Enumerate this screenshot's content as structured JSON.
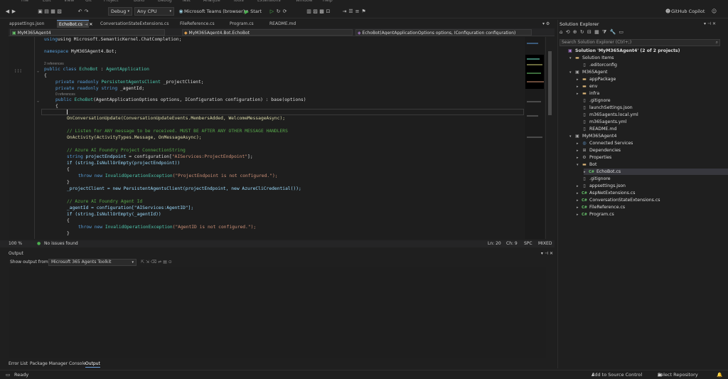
{
  "menubar": [
    "File",
    "Edit",
    "View",
    "Git",
    "Project",
    "Build",
    "Debug",
    "Test",
    "Analyze",
    "Tools",
    "Extensions",
    "Window",
    "Help"
  ],
  "toolbar": {
    "config": "Debug",
    "platform": "Any CPU",
    "launch_target": "Microsoft Teams (browser)",
    "start_label": "Start",
    "copilot_label": "GitHub Copilot"
  },
  "tabs": [
    {
      "label": "appsettings.json",
      "active": false
    },
    {
      "label": "EchoBot.cs",
      "active": true
    },
    {
      "label": "ConversationStateExtensions.cs",
      "active": false
    },
    {
      "label": "FileReference.cs",
      "active": false
    },
    {
      "label": "Program.cs",
      "active": false
    },
    {
      "label": "README.md",
      "active": false
    }
  ],
  "navbar": {
    "project": "MyM365Agent4",
    "class": "MyM365Agent4.Bot.EchoBot",
    "member": "EchoBot(AgentApplicationOptions options, IConfiguration configuration)"
  },
  "code": {
    "line_using": "using Microsoft.SemanticKernel.ChatCompletion;",
    "line_ns_kw": "namespace",
    "line_ns": " MyM365Agent4.Bot;",
    "refs_2": "2 references",
    "refs_0": "0 references",
    "class_kw": "public class",
    "class_name": " EchoBot",
    "class_base": " : ",
    "class_base_name": "AgentApplication",
    "brace_open": "{",
    "brace_close": "}",
    "field1_kw": "private readonly",
    "field1_type": " PersistentAgentsClient",
    "field1_name": " _projectClient;",
    "field2_kw": "private readonly string",
    "field2_name": " _agentId;",
    "ctor_kw": "public",
    "ctor_name": " EchoBot",
    "ctor_args": "(AgentApplicationOptions options, IConfiguration configuration) : base(options)",
    "onconv": "OnConversationUpdate(ConversationUpdateEvents.MembersAdded, WelcomeMessageAsync);",
    "comment1": "// Listen for ANY message to be received. MUST BE AFTER ANY OTHER MESSAGE HANDLERS",
    "onactivity": "OnActivity(ActivityTypes.Message, OnMessageAsync);",
    "comment2": "// Azure AI Foundry Project ConnectionString",
    "pe_kw": "string",
    "pe_name": " projectEndpoint",
    "pe_assign": " = configuration[",
    "pe_str": "\"AIServices:ProjectEndpoint\"",
    "pe_end": "];",
    "if1": "if (string.IsNullOrEmpty(projectEndpoint))",
    "throw_kw": "throw new",
    "throw_type": " InvalidOperationException",
    "throw1_str": "(\"ProjectEndpoint is not configured.\");",
    "projclient": "_projectClient = new PersistentAgentsClient(projectEndpoint, new AzureCliCredential());",
    "comment3": "// Azure AI Foundry Agent Id",
    "agentid": "_agentId = configuration[\"AIServices:AgentID\"];",
    "if2": "if (string.IsNullOrEmpty(_agentId))",
    "throw2_str": "(\"AgentID is not configured.\");"
  },
  "editor_status": {
    "zoom": "100 %",
    "issues": "No issues found",
    "line": "Ln: 20",
    "col": "Ch: 9",
    "spc": "SPC",
    "eol": "MIXED"
  },
  "output": {
    "title": "Output",
    "show_from": "Show output from:",
    "source": "Microsoft 365 Agents Toolkit"
  },
  "bottom_tabs": [
    "Error List",
    "Package Manager Console",
    "Output"
  ],
  "status": {
    "ready": "Ready",
    "source_control": "Add to Source Control",
    "repo": "Select Repository"
  },
  "solution_explorer": {
    "title": "Solution Explorer",
    "search_placeholder": "Search Solution Explorer (Ctrl+;)",
    "items": [
      {
        "label": "Solution 'MyM365Agent4' (2 of 2 projects)",
        "depth": 0,
        "kind": "solution",
        "arrow": ""
      },
      {
        "label": "Solution Items",
        "depth": 1,
        "kind": "folder",
        "arrow": "▾"
      },
      {
        "label": ".editorconfig",
        "depth": 2,
        "kind": "file",
        "arrow": ""
      },
      {
        "label": "M365Agent",
        "depth": 1,
        "kind": "project",
        "arrow": "▾"
      },
      {
        "label": "appPackage",
        "depth": 2,
        "kind": "folder",
        "arrow": "▸"
      },
      {
        "label": "env",
        "depth": 2,
        "kind": "folder",
        "arrow": "▸"
      },
      {
        "label": "infra",
        "depth": 2,
        "kind": "folder",
        "arrow": "▸"
      },
      {
        "label": ".gitignore",
        "depth": 2,
        "kind": "file",
        "arrow": ""
      },
      {
        "label": "launchSettings.json",
        "depth": 2,
        "kind": "file",
        "arrow": ""
      },
      {
        "label": "m365agents.local.yml",
        "depth": 2,
        "kind": "file",
        "arrow": ""
      },
      {
        "label": "m365agents.yml",
        "depth": 2,
        "kind": "file",
        "arrow": ""
      },
      {
        "label": "README.md",
        "depth": 2,
        "kind": "file",
        "arrow": ""
      },
      {
        "label": "MyM365Agent4",
        "depth": 1,
        "kind": "project",
        "arrow": "▾"
      },
      {
        "label": "Connected Services",
        "depth": 2,
        "kind": "service",
        "arrow": "▸"
      },
      {
        "label": "Dependencies",
        "depth": 2,
        "kind": "deps",
        "arrow": "▸"
      },
      {
        "label": "Properties",
        "depth": 2,
        "kind": "props",
        "arrow": "▸"
      },
      {
        "label": "Bot",
        "depth": 2,
        "kind": "folder",
        "arrow": "▾"
      },
      {
        "label": "EchoBot.cs",
        "depth": 3,
        "kind": "cs",
        "arrow": "▸"
      },
      {
        "label": ".gitignore",
        "depth": 2,
        "kind": "file",
        "arrow": ""
      },
      {
        "label": "appsettings.json",
        "depth": 2,
        "kind": "file",
        "arrow": "▸"
      },
      {
        "label": "AspNetExtensions.cs",
        "depth": 2,
        "kind": "cs",
        "arrow": "▸"
      },
      {
        "label": "ConversationStateExtensions.cs",
        "depth": 2,
        "kind": "cs",
        "arrow": "▸"
      },
      {
        "label": "FileReference.cs",
        "depth": 2,
        "kind": "cs",
        "arrow": "▸"
      },
      {
        "label": "Program.cs",
        "depth": 2,
        "kind": "cs",
        "arrow": "▸"
      }
    ]
  },
  "colors": {
    "accent": "#0078d4",
    "keyword": "#569cd6",
    "type": "#4ec9b0",
    "string": "#ce9178",
    "comment": "#57a64a"
  }
}
